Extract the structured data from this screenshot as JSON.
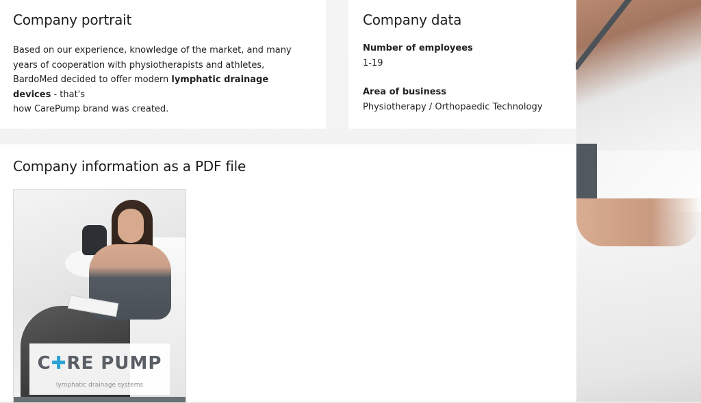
{
  "portrait": {
    "title": "Company portrait",
    "text_part1": "Based on our experience, knowledge of the market, and many years of cooperation with physiotherapists and athletes, BardoMed decided to offer modern ",
    "text_bold": "lymphatic drainage devices",
    "text_part2": " - that's",
    "text_part3": "how CarePump brand was created."
  },
  "company_data": {
    "title": "Company data",
    "employees_label": "Number of employees",
    "employees_value": "1-19",
    "business_label": "Area of business",
    "business_value": "Physiotherapy / Orthopaedic Technology"
  },
  "pdf": {
    "title": "Company information as a PDF file",
    "thumbnail": {
      "logo_left": "C",
      "logo_mark": "✚",
      "logo_right": "RE PUMP",
      "tagline": "lymphatic drainage systems"
    }
  },
  "colors": {
    "panel": "#ffffff",
    "text": "#1f1f1f",
    "logo_gray": "#5a5f66",
    "logo_accent": "#2ba3d6"
  }
}
